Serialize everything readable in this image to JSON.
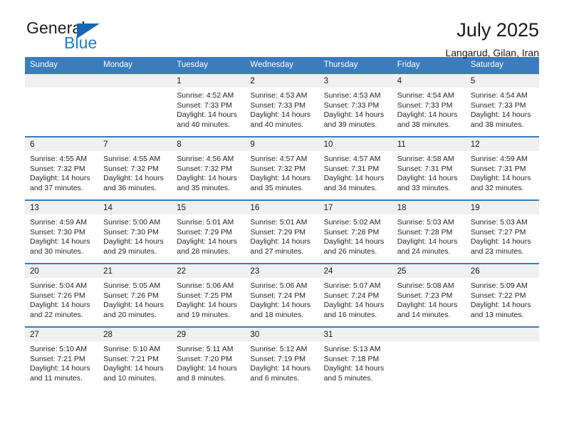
{
  "logo": {
    "line1": "General",
    "line2": "Blue",
    "triangle_color": "#1668b5",
    "blue_text_color": "#1c7fd0",
    "icon": "triangle-logo-icon"
  },
  "header": {
    "title": "July 2025",
    "subtitle": "Langarud, Gilan, Iran"
  },
  "theme": {
    "header_blue": "#3a7cbe",
    "daynum_band": "#f0f0f0",
    "text": "#1a1a1a"
  },
  "weekdays": [
    "Sunday",
    "Monday",
    "Tuesday",
    "Wednesday",
    "Thursday",
    "Friday",
    "Saturday"
  ],
  "weeks": [
    [
      {
        "day": "",
        "sunrise": "",
        "sunset": "",
        "daylight1": "",
        "daylight2": ""
      },
      {
        "day": "",
        "sunrise": "",
        "sunset": "",
        "daylight1": "",
        "daylight2": ""
      },
      {
        "day": "1",
        "sunrise": "Sunrise: 4:52 AM",
        "sunset": "Sunset: 7:33 PM",
        "daylight1": "Daylight: 14 hours",
        "daylight2": "and 40 minutes."
      },
      {
        "day": "2",
        "sunrise": "Sunrise: 4:53 AM",
        "sunset": "Sunset: 7:33 PM",
        "daylight1": "Daylight: 14 hours",
        "daylight2": "and 40 minutes."
      },
      {
        "day": "3",
        "sunrise": "Sunrise: 4:53 AM",
        "sunset": "Sunset: 7:33 PM",
        "daylight1": "Daylight: 14 hours",
        "daylight2": "and 39 minutes."
      },
      {
        "day": "4",
        "sunrise": "Sunrise: 4:54 AM",
        "sunset": "Sunset: 7:33 PM",
        "daylight1": "Daylight: 14 hours",
        "daylight2": "and 38 minutes."
      },
      {
        "day": "5",
        "sunrise": "Sunrise: 4:54 AM",
        "sunset": "Sunset: 7:33 PM",
        "daylight1": "Daylight: 14 hours",
        "daylight2": "and 38 minutes."
      }
    ],
    [
      {
        "day": "6",
        "sunrise": "Sunrise: 4:55 AM",
        "sunset": "Sunset: 7:32 PM",
        "daylight1": "Daylight: 14 hours",
        "daylight2": "and 37 minutes."
      },
      {
        "day": "7",
        "sunrise": "Sunrise: 4:55 AM",
        "sunset": "Sunset: 7:32 PM",
        "daylight1": "Daylight: 14 hours",
        "daylight2": "and 36 minutes."
      },
      {
        "day": "8",
        "sunrise": "Sunrise: 4:56 AM",
        "sunset": "Sunset: 7:32 PM",
        "daylight1": "Daylight: 14 hours",
        "daylight2": "and 35 minutes."
      },
      {
        "day": "9",
        "sunrise": "Sunrise: 4:57 AM",
        "sunset": "Sunset: 7:32 PM",
        "daylight1": "Daylight: 14 hours",
        "daylight2": "and 35 minutes."
      },
      {
        "day": "10",
        "sunrise": "Sunrise: 4:57 AM",
        "sunset": "Sunset: 7:31 PM",
        "daylight1": "Daylight: 14 hours",
        "daylight2": "and 34 minutes."
      },
      {
        "day": "11",
        "sunrise": "Sunrise: 4:58 AM",
        "sunset": "Sunset: 7:31 PM",
        "daylight1": "Daylight: 14 hours",
        "daylight2": "and 33 minutes."
      },
      {
        "day": "12",
        "sunrise": "Sunrise: 4:59 AM",
        "sunset": "Sunset: 7:31 PM",
        "daylight1": "Daylight: 14 hours",
        "daylight2": "and 32 minutes."
      }
    ],
    [
      {
        "day": "13",
        "sunrise": "Sunrise: 4:59 AM",
        "sunset": "Sunset: 7:30 PM",
        "daylight1": "Daylight: 14 hours",
        "daylight2": "and 30 minutes."
      },
      {
        "day": "14",
        "sunrise": "Sunrise: 5:00 AM",
        "sunset": "Sunset: 7:30 PM",
        "daylight1": "Daylight: 14 hours",
        "daylight2": "and 29 minutes."
      },
      {
        "day": "15",
        "sunrise": "Sunrise: 5:01 AM",
        "sunset": "Sunset: 7:29 PM",
        "daylight1": "Daylight: 14 hours",
        "daylight2": "and 28 minutes."
      },
      {
        "day": "16",
        "sunrise": "Sunrise: 5:01 AM",
        "sunset": "Sunset: 7:29 PM",
        "daylight1": "Daylight: 14 hours",
        "daylight2": "and 27 minutes."
      },
      {
        "day": "17",
        "sunrise": "Sunrise: 5:02 AM",
        "sunset": "Sunset: 7:28 PM",
        "daylight1": "Daylight: 14 hours",
        "daylight2": "and 26 minutes."
      },
      {
        "day": "18",
        "sunrise": "Sunrise: 5:03 AM",
        "sunset": "Sunset: 7:28 PM",
        "daylight1": "Daylight: 14 hours",
        "daylight2": "and 24 minutes."
      },
      {
        "day": "19",
        "sunrise": "Sunrise: 5:03 AM",
        "sunset": "Sunset: 7:27 PM",
        "daylight1": "Daylight: 14 hours",
        "daylight2": "and 23 minutes."
      }
    ],
    [
      {
        "day": "20",
        "sunrise": "Sunrise: 5:04 AM",
        "sunset": "Sunset: 7:26 PM",
        "daylight1": "Daylight: 14 hours",
        "daylight2": "and 22 minutes."
      },
      {
        "day": "21",
        "sunrise": "Sunrise: 5:05 AM",
        "sunset": "Sunset: 7:26 PM",
        "daylight1": "Daylight: 14 hours",
        "daylight2": "and 20 minutes."
      },
      {
        "day": "22",
        "sunrise": "Sunrise: 5:06 AM",
        "sunset": "Sunset: 7:25 PM",
        "daylight1": "Daylight: 14 hours",
        "daylight2": "and 19 minutes."
      },
      {
        "day": "23",
        "sunrise": "Sunrise: 5:06 AM",
        "sunset": "Sunset: 7:24 PM",
        "daylight1": "Daylight: 14 hours",
        "daylight2": "and 18 minutes."
      },
      {
        "day": "24",
        "sunrise": "Sunrise: 5:07 AM",
        "sunset": "Sunset: 7:24 PM",
        "daylight1": "Daylight: 14 hours",
        "daylight2": "and 16 minutes."
      },
      {
        "day": "25",
        "sunrise": "Sunrise: 5:08 AM",
        "sunset": "Sunset: 7:23 PM",
        "daylight1": "Daylight: 14 hours",
        "daylight2": "and 14 minutes."
      },
      {
        "day": "26",
        "sunrise": "Sunrise: 5:09 AM",
        "sunset": "Sunset: 7:22 PM",
        "daylight1": "Daylight: 14 hours",
        "daylight2": "and 13 minutes."
      }
    ],
    [
      {
        "day": "27",
        "sunrise": "Sunrise: 5:10 AM",
        "sunset": "Sunset: 7:21 PM",
        "daylight1": "Daylight: 14 hours",
        "daylight2": "and 11 minutes."
      },
      {
        "day": "28",
        "sunrise": "Sunrise: 5:10 AM",
        "sunset": "Sunset: 7:21 PM",
        "daylight1": "Daylight: 14 hours",
        "daylight2": "and 10 minutes."
      },
      {
        "day": "29",
        "sunrise": "Sunrise: 5:11 AM",
        "sunset": "Sunset: 7:20 PM",
        "daylight1": "Daylight: 14 hours",
        "daylight2": "and 8 minutes."
      },
      {
        "day": "30",
        "sunrise": "Sunrise: 5:12 AM",
        "sunset": "Sunset: 7:19 PM",
        "daylight1": "Daylight: 14 hours",
        "daylight2": "and 6 minutes."
      },
      {
        "day": "31",
        "sunrise": "Sunrise: 5:13 AM",
        "sunset": "Sunset: 7:18 PM",
        "daylight1": "Daylight: 14 hours",
        "daylight2": "and 5 minutes."
      },
      {
        "day": "",
        "sunrise": "",
        "sunset": "",
        "daylight1": "",
        "daylight2": ""
      },
      {
        "day": "",
        "sunrise": "",
        "sunset": "",
        "daylight1": "",
        "daylight2": ""
      }
    ]
  ]
}
